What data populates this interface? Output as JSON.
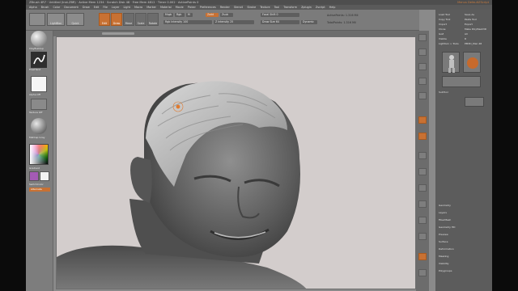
{
  "window": {
    "title": "ZBrush 4R7 · Untitled (Inst.ZBR) · Active Mem 1234 · Scratch Disk 48 · Free Mem 4812 · Timer 0.002 · ActivePoints 0",
    "menu_label": "Menus  DefaultZScript"
  },
  "menubar": {
    "items": [
      "Alpha",
      "Brush",
      "Color",
      "Document",
      "Draw",
      "Edit",
      "File",
      "Layer",
      "Light",
      "Macro",
      "Marker",
      "Material",
      "Movie",
      "Picker",
      "Preferences",
      "Render",
      "Stencil",
      "Stroke",
      "Texture",
      "Tool",
      "Transform",
      "Zplugin",
      "Zscript",
      "Help"
    ]
  },
  "topshelf": {
    "tools": [
      "Edit",
      "Draw",
      "Move",
      "Scale",
      "Rotate"
    ],
    "active_tools": [
      "Edit",
      "Draw"
    ],
    "mrgb_label": "Mrgb",
    "rgb_label": "Rgb",
    "m_label": "M",
    "zadd_label": "Zadd",
    "zsub_label": "Zsub",
    "zcut_label": "Zcut",
    "focal_label": "Focal Shift 0",
    "draw_size_label": "Draw Size 64",
    "dynamic_label": "Dynamic",
    "z_intensity_label": "Z Intensity 25",
    "rgb_intensity_label": "Rgb Intensity 100",
    "active_points": "ActivePoints: 1.316 Mil",
    "total_points": "TotalPoints: 1.316 Mil",
    "lightbox_label": "LightBox",
    "quick_sketch_label": "Quick Sketch"
  },
  "leftshelf": {
    "brush_label": "ClayBuildup",
    "stroke_label": "FreeHand",
    "alpha_label": "Alpha Off",
    "texture_label": "Texture Off",
    "material_label": "MatCap Gray",
    "gradient_label": "Gradient",
    "switch_color_label": "SwitchColor",
    "alternate_label": "Alternate"
  },
  "rightpanel": {
    "rows": [
      "Load Tool",
      "Save As",
      "Copy Tool",
      "Paste Tool",
      "Import",
      "Export",
      "Clone",
      "Make PolyMesh3D",
      "GoZ",
      "All",
      "Visible",
      "R",
      "Lightbox > Tools",
      "PM3D_Man 48"
    ],
    "subtools_label": "SubTool",
    "bottom_rows": [
      "Geometry",
      "Layers",
      "FiberMesh",
      "Geometry HD",
      "Preview",
      "Surface",
      "Deformation",
      "Masking",
      "Visibility",
      "Polygroups"
    ]
  },
  "colors": {
    "accent": "#c87133",
    "canvas_bg": "#d3cdcc",
    "panel_bg": "#5c5c5c"
  }
}
